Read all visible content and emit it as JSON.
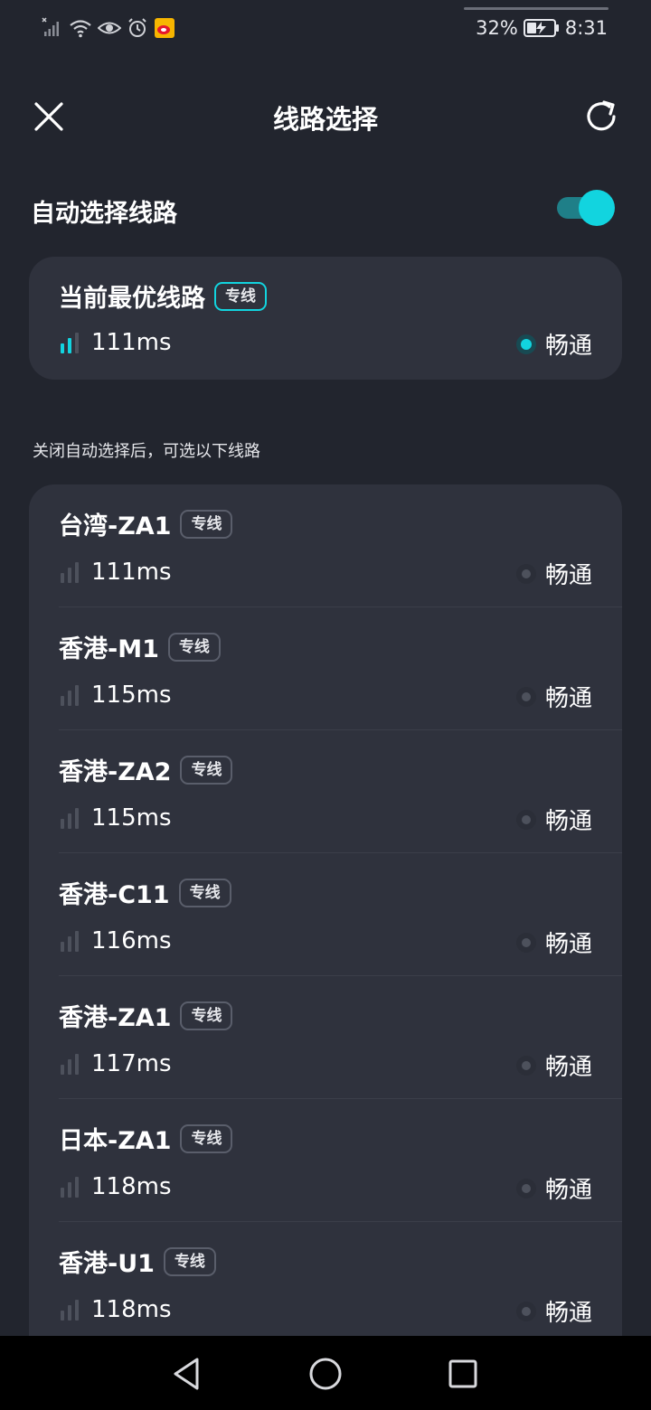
{
  "status_bar": {
    "battery_percent": "32%",
    "time": "8:31",
    "icons": [
      "signal-off-icon",
      "wifi-icon",
      "eye-icon",
      "alarm-icon",
      "weibo-app-icon",
      "battery-charging-icon"
    ]
  },
  "header": {
    "title": "线路选择",
    "close_icon": "close-icon",
    "refresh_icon": "refresh-icon"
  },
  "auto_select": {
    "label": "自动选择线路",
    "enabled": true
  },
  "best_route": {
    "title": "当前最优线路",
    "tag": "专线",
    "latency": "111ms",
    "status": "畅通",
    "selected": true
  },
  "hint": "关闭自动选择后，可选以下线路",
  "routes": [
    {
      "name": "台湾-ZA1",
      "tag": "专线",
      "latency": "111ms",
      "status": "畅通"
    },
    {
      "name": "香港-M1",
      "tag": "专线",
      "latency": "115ms",
      "status": "畅通"
    },
    {
      "name": "香港-ZA2",
      "tag": "专线",
      "latency": "115ms",
      "status": "畅通"
    },
    {
      "name": "香港-C11",
      "tag": "专线",
      "latency": "116ms",
      "status": "畅通"
    },
    {
      "name": "香港-ZA1",
      "tag": "专线",
      "latency": "117ms",
      "status": "畅通"
    },
    {
      "name": "日本-ZA1",
      "tag": "专线",
      "latency": "118ms",
      "status": "畅通"
    },
    {
      "name": "香港-U1",
      "tag": "专线",
      "latency": "118ms",
      "status": "畅通"
    }
  ],
  "colors": {
    "background": "#22252e",
    "card": "#2f323d",
    "accent": "#12d4df"
  },
  "nav_bar": {
    "icons": [
      "back-icon",
      "home-icon",
      "recents-icon"
    ]
  }
}
